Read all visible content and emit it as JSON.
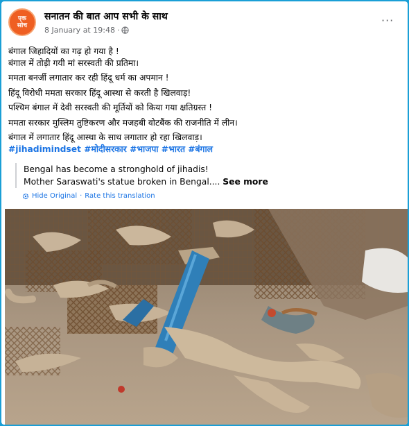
{
  "post": {
    "page_name": "सनातन की बात आप सभी के साथ",
    "avatar_text_top": "एक",
    "avatar_text_bottom": "सोच",
    "timestamp": "8 January at 19:48",
    "separator": "·",
    "more_label": "···",
    "lines": [
      "बंगाल जिहादियों का गढ़ हो गया है !",
      "बंगाल में तोड़ी गयी मां सरस्वती की प्रतिमा।",
      "ममता बनर्जी लगातार कर रही हिंदू धर्म का अपमान !",
      "हिंदू विरोधी ममता सरकार हिंदू आस्था से करती है खिलवाड़!",
      "पश्चिम बंगाल में देवी सरस्वती की मूर्तियों को किया गया क्षतिग्रस्त !",
      "ममता सरकार मुस्लिम तुष्टिकरण और मजहबी वोटबैंक की राजनीति में लीन।",
      "बंगाल में लगातार हिंदू आस्था के साथ लगातार हो रहा खिलवाड़।"
    ],
    "hashtags": [
      "#jihadimindset",
      "#मोदीसरकार",
      "#भाजपा",
      "#भारत",
      "#बंगाल"
    ]
  },
  "translation": {
    "line1": "Bengal has become a stronghold of jihadis!",
    "line2": "Mother Saraswati's statue broken in Bengal....",
    "see_more": "See more",
    "hide_original": "Hide Original",
    "dot": "·",
    "rate": "Rate this translation"
  },
  "colors": {
    "background": "#1a9fd6",
    "link": "#1b74e4",
    "avatar": "#ef5f22"
  },
  "icons": {
    "globe": "globe-icon",
    "gear": "gear-icon",
    "more": "more-options-icon"
  }
}
